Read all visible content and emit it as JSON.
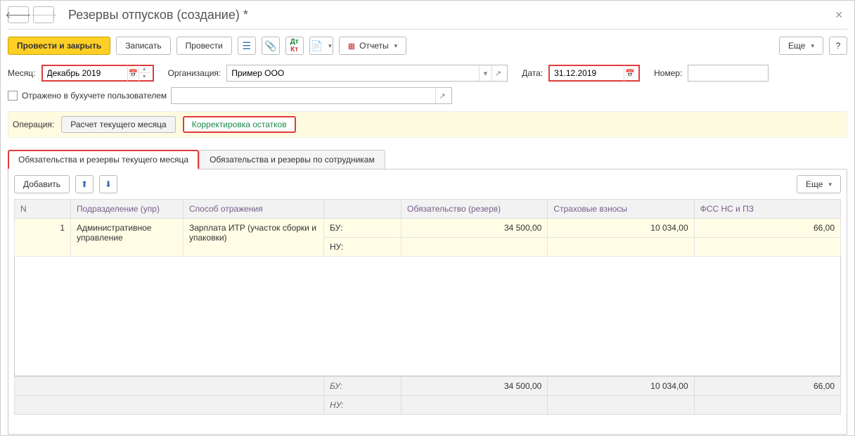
{
  "title": "Резервы отпусков (создание) *",
  "toolbar": {
    "post_close": "Провести и закрыть",
    "save": "Записать",
    "post": "Провести",
    "reports": "Отчеты",
    "more": "Еще"
  },
  "form": {
    "month_label": "Месяц:",
    "month_value": "Декабрь 2019",
    "org_label": "Организация:",
    "org_value": "Пример ООО",
    "date_label": "Дата:",
    "date_value": "31.12.2019",
    "number_label": "Номер:",
    "number_value": "",
    "posted_by_user_label": "Отражено в бухучете пользователем",
    "posted_by_user_value": ""
  },
  "operation": {
    "label": "Операция:",
    "calc": "Расчет текущего месяца",
    "correct": "Корректировка остатков"
  },
  "tabs": {
    "t1": "Обязательства и резервы текущего месяца",
    "t2": "Обязательства и резервы по сотрудникам"
  },
  "list": {
    "add": "Добавить",
    "more": "Еще",
    "columns": {
      "n": "N",
      "dept": "Подразделение (упр)",
      "method": "Способ отражения",
      "type": "",
      "obl": "Обязательство (резерв)",
      "ins": "Страховые взносы",
      "fss": "ФСС НС и ПЗ"
    },
    "row": {
      "n": "1",
      "dept": "Административное управление",
      "method": "Зарплата ИТР (участок сборки и упаковки)",
      "bu": "БУ:",
      "nu": "НУ:",
      "obl_bu": "34 500,00",
      "ins_bu": "10 034,00",
      "fss_bu": "66,00"
    },
    "footer": {
      "bu": "БУ:",
      "nu": "НУ:",
      "obl": "34 500,00",
      "ins": "10 034,00",
      "fss": "66,00"
    }
  }
}
